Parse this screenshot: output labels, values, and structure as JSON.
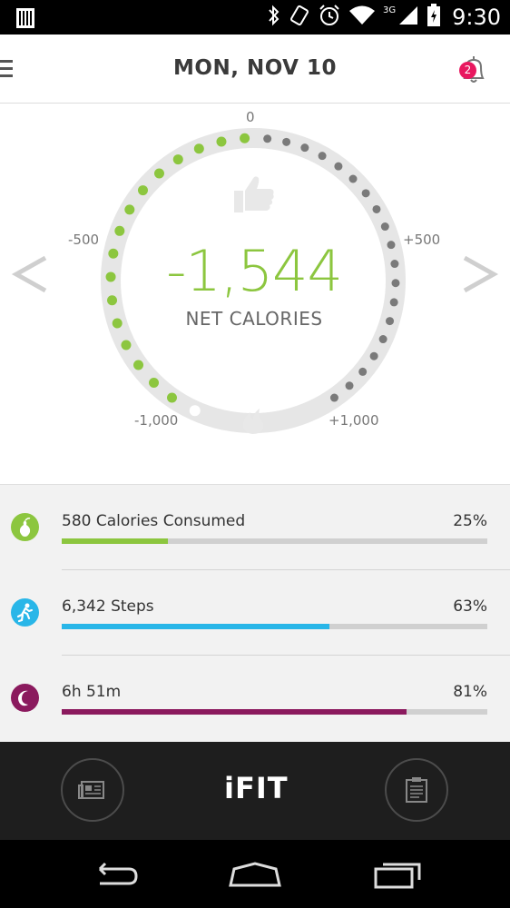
{
  "status_bar": {
    "network": "3G",
    "time": "9:30"
  },
  "header": {
    "title": "MON, NOV 10",
    "notifications_count": "2"
  },
  "gauge": {
    "value": "-1,544",
    "label": "NET CALORIES",
    "ticks": {
      "top": "0",
      "left": "-500",
      "right": "+500",
      "bottom_left": "-1,000",
      "bottom_right": "+1,000"
    },
    "range": [
      -1000,
      1000
    ],
    "current": -1544
  },
  "stats": [
    {
      "label": "580 Calories Consumed",
      "percent": "25%",
      "fraction": 0.25,
      "color": "#8cc63f",
      "icon": "pear-icon"
    },
    {
      "label": "6,342 Steps",
      "percent": "63%",
      "fraction": 0.63,
      "color": "#29b6e8",
      "icon": "runner-icon"
    },
    {
      "label": "6h 51m",
      "percent": "81%",
      "fraction": 0.81,
      "color": "#8b1a5e",
      "icon": "moon-icon"
    }
  ],
  "bottom_bar": {
    "logo": "iFIT"
  },
  "colors": {
    "accent_green": "#8cc63f",
    "steps_blue": "#29b6e8",
    "sleep_purple": "#8b1a5e",
    "inactive_dot": "#7a7a7a",
    "ring": "#e6e6e6"
  }
}
